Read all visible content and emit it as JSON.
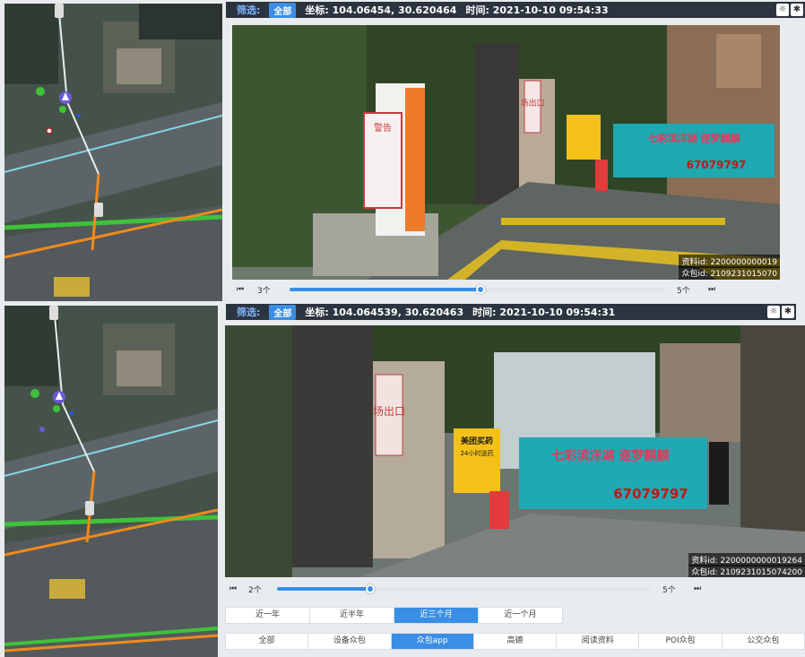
{
  "top_panel": {
    "filter_label": "筛选:",
    "filter_chip": "全部",
    "coord": "坐标: 104.06454, 30.620464",
    "time": "时间: 2021-10-10 09:54:33",
    "tool_a": "☼",
    "tool_b": "✱",
    "watermark_line1": "资料id: 2200000000019",
    "watermark_line2": "众包id: 2109231015070",
    "player": {
      "prev": "⏮",
      "next": "⏭",
      "start_label": "3个",
      "end_label": "5个",
      "progress": 0.51
    }
  },
  "bottom_panel": {
    "filter_label": "筛选:",
    "filter_chip": "全部",
    "coord": "坐标: 104.064539, 30.620463",
    "time": "时间: 2021-10-10 09:54:31",
    "tool_a": "☼",
    "tool_b": "✱",
    "watermark_line1": "资料id: 2200000000019264",
    "watermark_line2": "众包id: 2109231015074200",
    "player": {
      "prev": "⏮",
      "next": "⏭",
      "start_label": "2个",
      "end_label": "5个",
      "progress": 0.25
    }
  },
  "photo_signs": {
    "warning": "警告",
    "exit": "场出口",
    "pharmacy": "美团买药",
    "pharmacy_sub": "24小时送药",
    "banner_slogan": "七彩滨洋湖 逐梦麒麟",
    "banner_phone": "67079797"
  },
  "time_tabs": [
    {
      "label": "近一年",
      "active": false
    },
    {
      "label": "近半年",
      "active": false
    },
    {
      "label": "近三个月",
      "active": true
    },
    {
      "label": "近一个月",
      "active": false
    }
  ],
  "source_tabs": [
    {
      "label": "全部",
      "active": false
    },
    {
      "label": "设备众包",
      "active": false
    },
    {
      "label": "众包app",
      "active": true
    },
    {
      "label": "高德",
      "active": false
    },
    {
      "label": "阅读资料",
      "active": false
    },
    {
      "label": "POI众包",
      "active": false
    },
    {
      "label": "公交众包",
      "active": false
    }
  ],
  "colors": {
    "accent": "#3a8ee6",
    "header_bg": "#2c3440",
    "road_green": "#3fc23a",
    "road_orange": "#f08a1c"
  }
}
